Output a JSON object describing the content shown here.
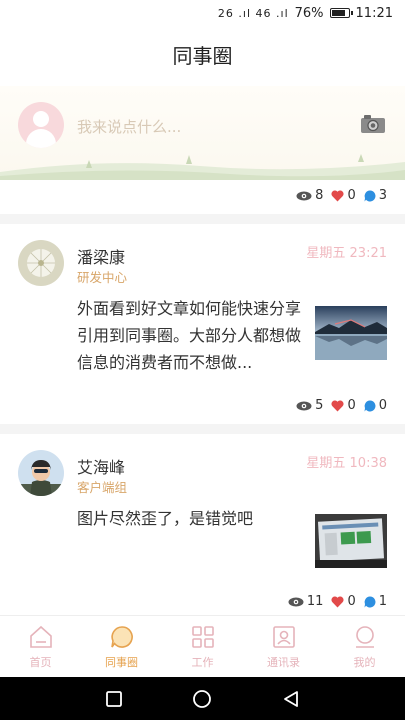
{
  "status_bar": {
    "signal": "26 .ıl 46 .ıl",
    "battery": "76%",
    "battery_level": 0.76,
    "time": "11:21"
  },
  "title": "同事圈",
  "composer": {
    "placeholder": "我来说点什么..."
  },
  "composer_stats": {
    "views": "8",
    "likes": "0",
    "comments": "3"
  },
  "posts": [
    {
      "name": "潘梁康",
      "dept": "研发中心",
      "time": "星期五 23:21",
      "text": "外面看到好文章如何能快速分享引用到同事圈。大部分人都想做信息的消费者而不想做...",
      "views": "5",
      "likes": "0",
      "comments": "0"
    },
    {
      "name": "艾海峰",
      "dept": "客户端组",
      "time": "星期五 10:38",
      "text": "图片尽然歪了，是错觉吧",
      "views": "11",
      "likes": "0",
      "comments": "1"
    }
  ],
  "nav": [
    {
      "label": "首页",
      "icon": "home-icon"
    },
    {
      "label": "同事圈",
      "icon": "chat-bubble-icon",
      "active": true
    },
    {
      "label": "工作",
      "icon": "grid-icon"
    },
    {
      "label": "通讯录",
      "icon": "contacts-icon"
    },
    {
      "label": "我的",
      "icon": "user-icon"
    }
  ],
  "colors": {
    "accent": "#e6a350",
    "muted_pink": "#e5b3ba",
    "like_red": "#e24a4a",
    "comment_blue": "#2d8fe0",
    "dept": "#d8a66a"
  }
}
